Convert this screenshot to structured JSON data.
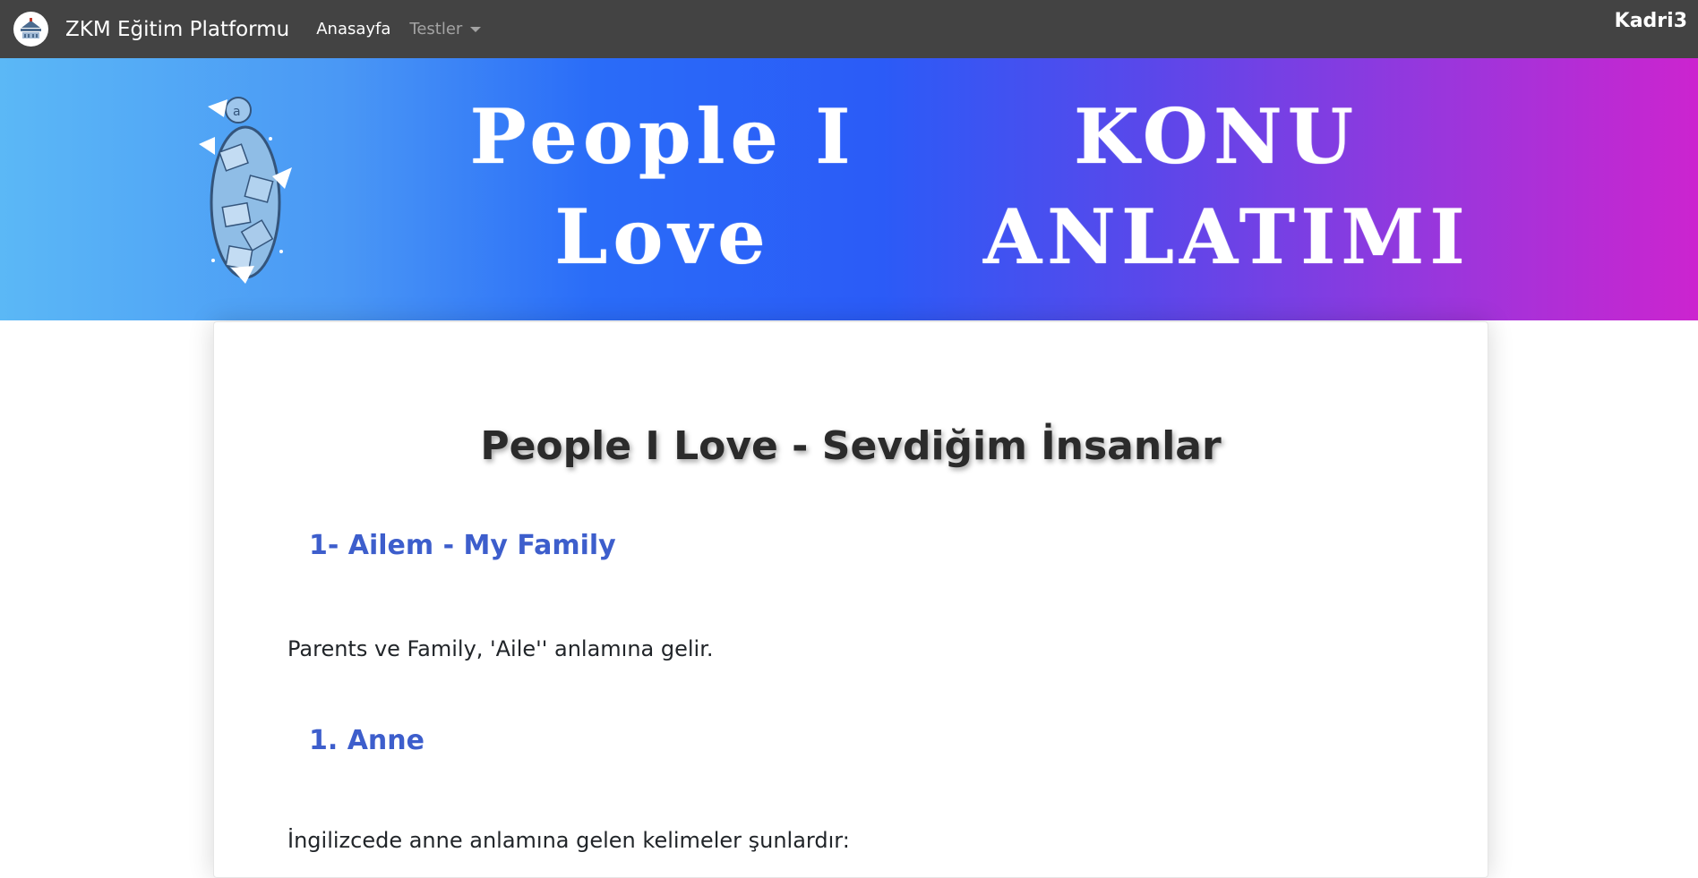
{
  "navbar": {
    "brand": "ZKM Eğitim Platformu",
    "logo_icon": "school-building-icon",
    "links": [
      {
        "label": "Anasayfa"
      }
    ],
    "dropdown": {
      "label": "Testler"
    },
    "user": "Kadri3"
  },
  "banner": {
    "title_left": [
      "People I",
      "Love"
    ],
    "title_right": [
      "KONU",
      "ANLATIMI"
    ],
    "art_icon": "word-jar-icon",
    "colors": {
      "gradient_start": "#5bb8f6",
      "gradient_mid": "#2b5bf7",
      "gradient_end": "#cc24cf"
    }
  },
  "content": {
    "title": "People I Love - Sevdiğim İnsanlar",
    "sections": [
      {
        "heading": "1- Ailem - My Family",
        "paragraph": "Parents ve Family, 'Aile'' anlamına gelir."
      },
      {
        "heading": "1. Anne",
        "paragraph": "İngilizcede anne anlamına gelen kelimeler şunlardır:"
      }
    ],
    "heading_color": "#3d5ecc"
  }
}
